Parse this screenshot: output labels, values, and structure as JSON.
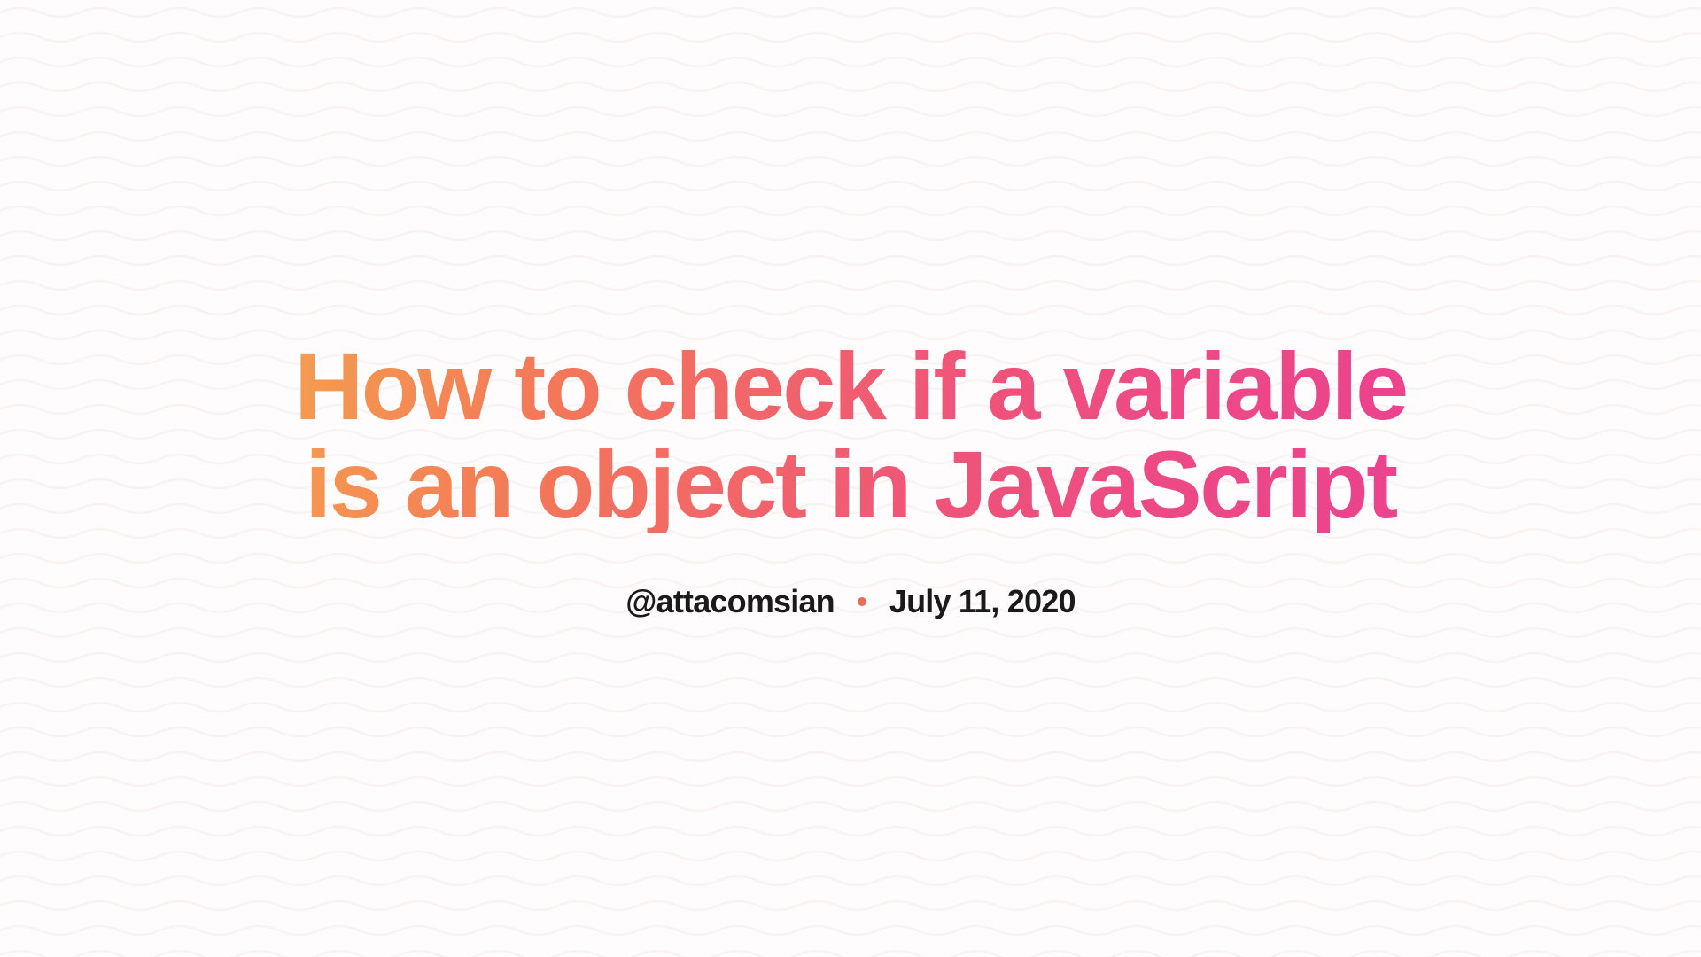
{
  "title": "How to check if a variable is an object in JavaScript",
  "author": "@attacomsian",
  "date": "July 11, 2020",
  "colors": {
    "gradientStart": "#f5a04e",
    "gradientEnd": "#ec428f",
    "separator": "#ed6a5a",
    "text": "#1a1a1a",
    "waves": "#f2e5e5",
    "background": "#fefcfc"
  }
}
